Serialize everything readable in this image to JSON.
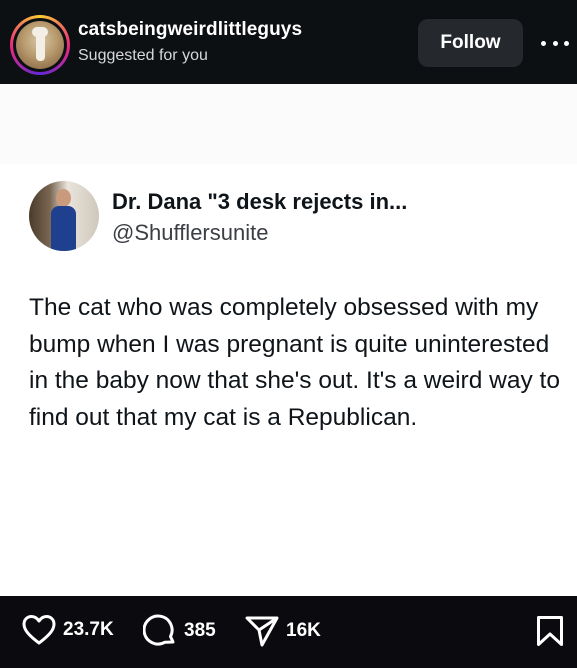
{
  "header": {
    "username": "catsbeingweirdlittleguys",
    "subtitle": "Suggested for you",
    "follow_label": "Follow",
    "more_icon": "more-horizontal-icon"
  },
  "tweet": {
    "display_name": "Dr. Dana \"3 desk rejects in...",
    "handle": "@Shufflersunite",
    "text": "The cat who was completely obsessed with my bump when I was pregnant is quite uninterested in the baby now that she's out. It's a weird way to find out that my cat is a Republican."
  },
  "actions": {
    "likes": "23.7K",
    "comments": "385",
    "shares": "16K"
  },
  "icons": {
    "like": "heart-icon",
    "comment": "comment-bubble-icon",
    "share": "paper-plane-icon",
    "save": "bookmark-icon"
  }
}
